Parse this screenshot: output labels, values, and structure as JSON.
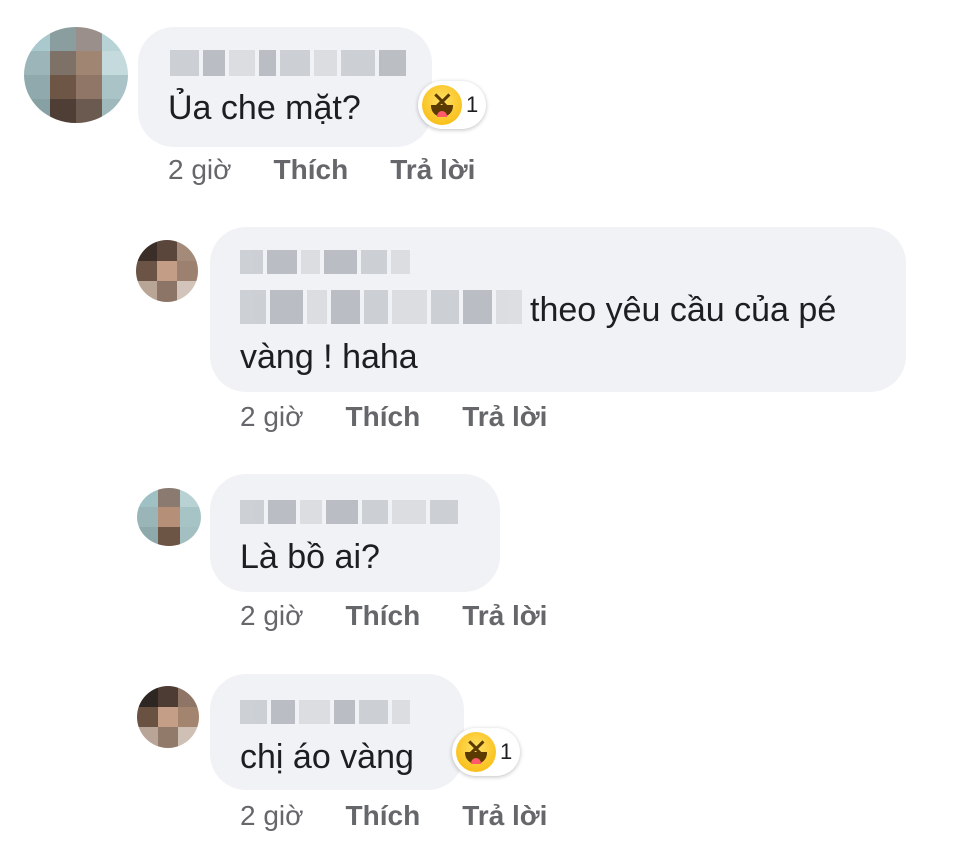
{
  "comments": [
    {
      "text_lines": [
        "Ủa che mặt?"
      ],
      "time": "2 giờ",
      "like_label": "Thích",
      "reply_label": "Trả lời",
      "reaction": {
        "icon": "haha-reaction-icon",
        "count": "1"
      }
    },
    {
      "text_lines": [
        "theo yêu cầu của pé",
        "vàng ! haha"
      ],
      "time": "2 giờ",
      "like_label": "Thích",
      "reply_label": "Trả lời"
    },
    {
      "text_lines": [
        "Là bồ ai?"
      ],
      "time": "2 giờ",
      "like_label": "Thích",
      "reply_label": "Trả lời"
    },
    {
      "text_lines": [
        "chị áo vàng"
      ],
      "time": "2 giờ",
      "like_label": "Thích",
      "reply_label": "Trả lời",
      "reaction": {
        "icon": "haha-reaction-icon",
        "count": "1"
      }
    }
  ],
  "colors": {
    "bubble_bg": "#f0f2f5",
    "meta_text": "#65676b",
    "text": "#1c1e21",
    "haha_yellow": "#f7b500"
  }
}
